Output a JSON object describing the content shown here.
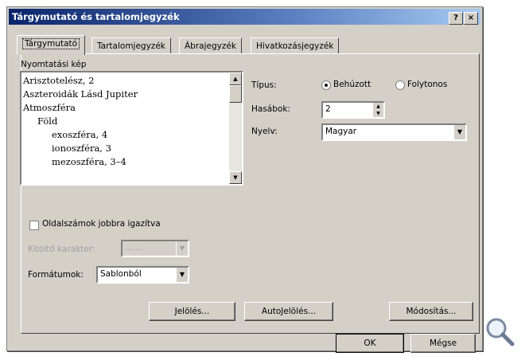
{
  "window": {
    "title": "Tárgymutató és tartalomjegyzék",
    "help_label": "?",
    "close_label": "×"
  },
  "tabs": [
    {
      "label": "Tárgymutató",
      "active": true
    },
    {
      "label": "Tartalomjegyzék",
      "active": false
    },
    {
      "label": "Ábrajegyzék",
      "active": false
    },
    {
      "label": "Hivatkozásjegyzék",
      "active": false
    }
  ],
  "preview": {
    "label": "Nyomtatási kép",
    "items": [
      "Arisztotelész, 2",
      "Aszteroidák Lásd Jupiter",
      "Atmoszféra",
      "Föld",
      "exoszféra, 4",
      "ionoszféra, 3",
      "mezoszféra, 3–4"
    ]
  },
  "type": {
    "label": "Típus:",
    "options": [
      {
        "label": "Behúzott",
        "selected": true
      },
      {
        "label": "Folytonos",
        "selected": false
      }
    ]
  },
  "columns": {
    "label": "Hasábok:",
    "value": "2"
  },
  "language": {
    "label": "Nyelv:",
    "value": "Magyar"
  },
  "right_align": {
    "label": "Oldalszámok jobbra igazítva",
    "checked": false
  },
  "tab_leader": {
    "label": "Kitöltő karakter:",
    "value": "......."
  },
  "formats": {
    "label": "Formátumok:",
    "value": "Sablonból"
  },
  "buttons": {
    "mark": "Jelölés...",
    "automark": "AutoJelölés...",
    "modify": "Módosítás...",
    "ok": "OK",
    "cancel": "Mégse"
  },
  "colors": {
    "titlebar": "#0a246a",
    "face": "#d4d0c8"
  },
  "icons": {
    "zoom": "magnifier-icon"
  }
}
